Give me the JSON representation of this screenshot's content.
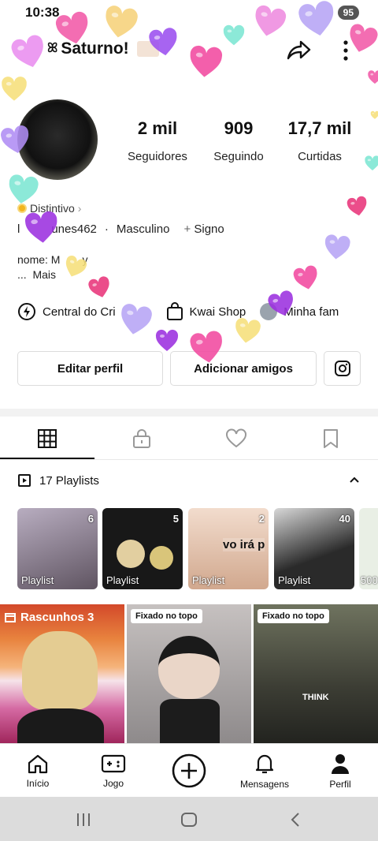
{
  "status": {
    "time": "10:38",
    "battery": "95"
  },
  "header": {
    "username": "Saturno!"
  },
  "stats": [
    {
      "value": "2 mil",
      "label": "Seguidores"
    },
    {
      "value": "909",
      "label": "Seguindo"
    },
    {
      "value": "17,7 mil",
      "label": "Curtidas"
    }
  ],
  "profile": {
    "badge": "Distintivo",
    "id_partial": "l",
    "id_partial_2": "unes462",
    "separator": "·",
    "gender": "Masculino",
    "sign": "Signo",
    "bio_line1": "nome: M",
    "bio_line1b": "y",
    "bio_more_dots": "...",
    "bio_more": "Mais"
  },
  "links": {
    "central": "Central do Cri",
    "shop": "Kwai Shop",
    "family": "Minha fam"
  },
  "buttons": {
    "edit": "Editar perfil",
    "add_friends": "Adicionar amigos"
  },
  "playlists": {
    "title": "17 Playlists",
    "items": [
      {
        "label": "Playlist",
        "count": "6",
        "color": "#8a7c8a"
      },
      {
        "label": "Playlist",
        "count": "5",
        "color": "#1b1b1b"
      },
      {
        "label": "Playlist",
        "count": "2",
        "color": "#c89a7a",
        "overlay": "vo irá p"
      },
      {
        "label": "Playlist",
        "count": "40",
        "color": "#3a3a3a"
      },
      {
        "label": "",
        "count": "500",
        "color": "#e9efe5"
      }
    ]
  },
  "grid": [
    {
      "title": "Rascunhos 3",
      "tag": ""
    },
    {
      "title": "",
      "tag": "Fixado no topo"
    },
    {
      "title": "",
      "tag": "Fixado no topo",
      "text": "THINK"
    }
  ],
  "nav": [
    {
      "label": "Início",
      "icon": "home-icon"
    },
    {
      "label": "Jogo",
      "icon": "gamepad-icon"
    },
    {
      "label": "",
      "icon": "plus-icon"
    },
    {
      "label": "Mensagens",
      "icon": "bell-icon"
    },
    {
      "label": "Perfil",
      "icon": "profile-icon"
    }
  ]
}
